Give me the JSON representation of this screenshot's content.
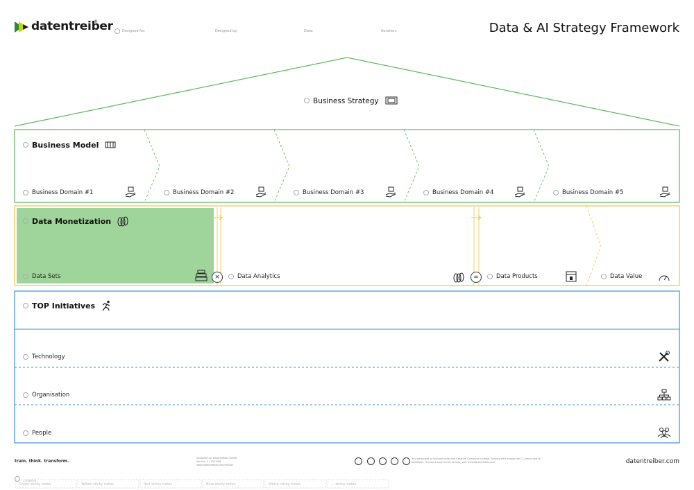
{
  "brand": {
    "name": "datentreiber",
    "mark": "®"
  },
  "header": {
    "fields": [
      "Designed for:",
      "Designed by:",
      "Date:",
      "Iteration:"
    ],
    "title": "Data & AI Strategy Framework"
  },
  "strategy": {
    "label": "Business Strategy"
  },
  "business_model": {
    "label": "Business Model",
    "domains": [
      "Business Domain #1",
      "Business Domain #2",
      "Business Domain #3",
      "Business Domain #4",
      "Business Domain #5"
    ]
  },
  "data_monetization": {
    "label": "Data Monetization",
    "steps": [
      "Data Sets",
      "Data Analytics",
      "Data Products",
      "Data Value"
    ],
    "operators": [
      "×",
      "="
    ]
  },
  "initiatives": {
    "label": "TOP Initiatives",
    "rows": [
      "Technology",
      "Organisation",
      "People"
    ]
  },
  "footer": {
    "tagline": "train. think. transform.",
    "credits": [
      "Designed by: Datentreiber GmbH",
      "Version: 2 / 2024/09",
      "www.datentreiber.com/canvas"
    ],
    "license": "This worksheet is licensed under the Creative Commons License. Sharing with adapts the CC-terms and all conditions. To view a copy of this license, visit www.datentreiber.com",
    "site": "datentreiber.com",
    "legend_label": "Legend",
    "legend": [
      "Green sticky notes",
      "Yellow sticky notes",
      "Red sticky notes",
      "Blue sticky notes",
      "White sticky notes",
      "... sticky notes"
    ]
  },
  "colors": {
    "green": "#5cb85c",
    "fill_green": "#9fd59a",
    "yellow": "#f3c43f",
    "blue": "#3d8fd6",
    "accent": "#c9d400"
  }
}
